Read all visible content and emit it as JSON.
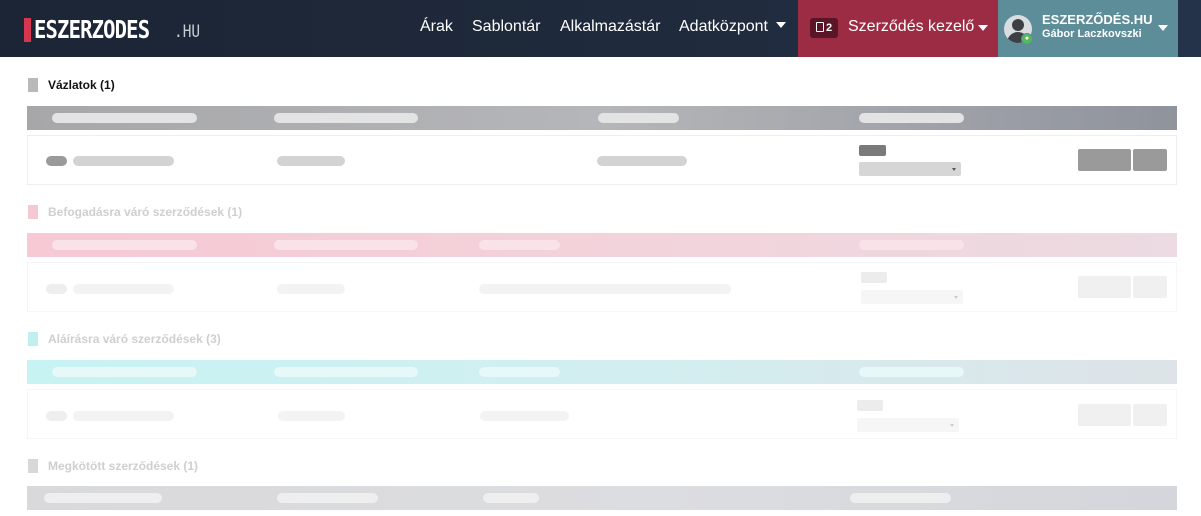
{
  "brand": {
    "name": "ESZERZODES",
    "tld": ".HU"
  },
  "nav": {
    "links": [
      "Árak",
      "Sablontár",
      "Alkalmazástár",
      "Adatközpont"
    ],
    "contract_manager": {
      "label": "Szerződés kezelő",
      "badge_count": "2"
    },
    "user": {
      "organization": "ESZERZŐDÉS.HU",
      "name": "Gábor Laczkovszki"
    }
  },
  "sections": [
    {
      "title": "Vázlatok (1)",
      "accent": "#b9b9b9"
    },
    {
      "title": "Befogadásra váró szerződések (1)",
      "accent": "#f5c9d3"
    },
    {
      "title": "Aláírásra váró szerződések (3)",
      "accent": "#bff0ef"
    },
    {
      "title": "Megkötött szerződések (1)",
      "accent": "#d8d8d8"
    }
  ],
  "colors": {
    "nav_bg": "#1c2535",
    "contract_manager_bg": "#9c2c44",
    "user_bg": "#5c8d98",
    "logo_accent": "#d5354f"
  },
  "icons": {
    "contract_manager": "document-icon",
    "user_avatar": "avatar-icon",
    "user_badge": "user-online-icon"
  }
}
